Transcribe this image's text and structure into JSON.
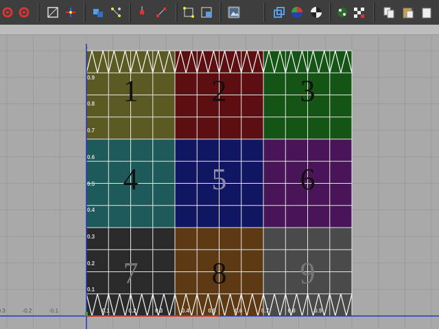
{
  "viewport": {
    "v_top_label": "1",
    "v_ticks": [
      "0.9",
      "0.8",
      "0.7",
      "0.6",
      "0.5",
      "0.4",
      "0.3",
      "0.2",
      "0.1"
    ],
    "u_neg_ticks": [
      "-0.3",
      "-0.2",
      "-0.1"
    ],
    "u_ticks": [
      "0.1",
      "0.2",
      "0.3",
      "0.4",
      "0.5",
      "0.6",
      "0.7",
      "0.8",
      "0.9"
    ],
    "tiles": [
      {
        "label": "1",
        "color": "#5a5a22"
      },
      {
        "label": "2",
        "color": "#5c0e10"
      },
      {
        "label": "3",
        "color": "#145414"
      },
      {
        "label": "4",
        "color": "#1f5a5a"
      },
      {
        "label": "5",
        "color": "#111662"
      },
      {
        "label": "6",
        "color": "#4a1458"
      },
      {
        "label": "7",
        "color": "#2a2a2a"
      },
      {
        "label": "8",
        "color": "#5e3a14"
      },
      {
        "label": "9",
        "color": "#4a4a4a"
      }
    ]
  },
  "toolbar": {
    "icons": [
      "undo-icon",
      "redo-icon",
      "grid-toggle-icon",
      "move-icon",
      "uv-layout-icon",
      "select-icon",
      "snap-icon",
      "normalize-icon",
      "unfold-icon",
      "image-icon",
      "shaded-icon",
      "checker-icon",
      "copy-icon",
      "paste-icon"
    ]
  }
}
